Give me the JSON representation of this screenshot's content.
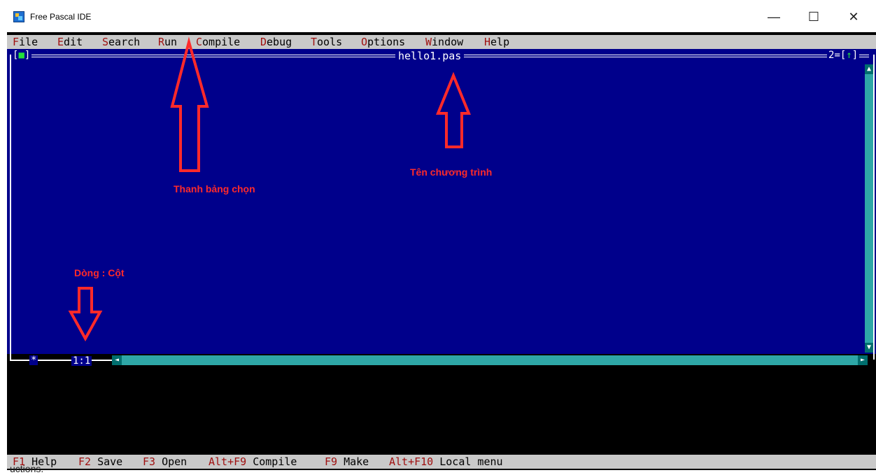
{
  "window": {
    "title": "Free Pascal IDE",
    "minimize_glyph": "—",
    "maximize_glyph": "☐",
    "close_glyph": "✕"
  },
  "menu": {
    "items": [
      {
        "hotkey": "F",
        "rest": "ile"
      },
      {
        "hotkey": "E",
        "rest": "dit"
      },
      {
        "hotkey": "S",
        "rest": "earch"
      },
      {
        "hotkey": "R",
        "rest": "un"
      },
      {
        "hotkey": "C",
        "rest": "ompile"
      },
      {
        "hotkey": "D",
        "rest": "ebug"
      },
      {
        "hotkey": "T",
        "rest": "ools"
      },
      {
        "hotkey": "O",
        "rest": "ptions"
      },
      {
        "hotkey": "W",
        "rest": "indow"
      },
      {
        "hotkey": "H",
        "rest": "elp"
      }
    ]
  },
  "editor": {
    "filename": "hello1.pas",
    "close_box_left": "[",
    "close_box_mark": "■",
    "close_box_right": "]",
    "window_number": "2",
    "zoom_left": "[",
    "zoom_mark": "↑",
    "zoom_right": "]",
    "modified_mark": "*",
    "cursor_position": "1:1",
    "scroll_up": "▲",
    "scroll_down": "▼",
    "scroll_left": "◄",
    "scroll_right": "►"
  },
  "statusbar": {
    "items": [
      {
        "key": "F1",
        "label": " Help"
      },
      {
        "key": "F2",
        "label": " Save"
      },
      {
        "key": "F3",
        "label": " Open"
      },
      {
        "key": "Alt+F9",
        "label": " Compile"
      },
      {
        "key": "F9",
        "label": " Make"
      },
      {
        "key": "Alt+F10",
        "label": " Local menu"
      }
    ]
  },
  "annotations": {
    "menu_bar_label": "Thanh bảng chọn",
    "program_name_label": "Tên chương trình",
    "line_col_label": "Dòng : Cột",
    "color": "#ff2a2a"
  },
  "page_footer_fragment": "uctions."
}
